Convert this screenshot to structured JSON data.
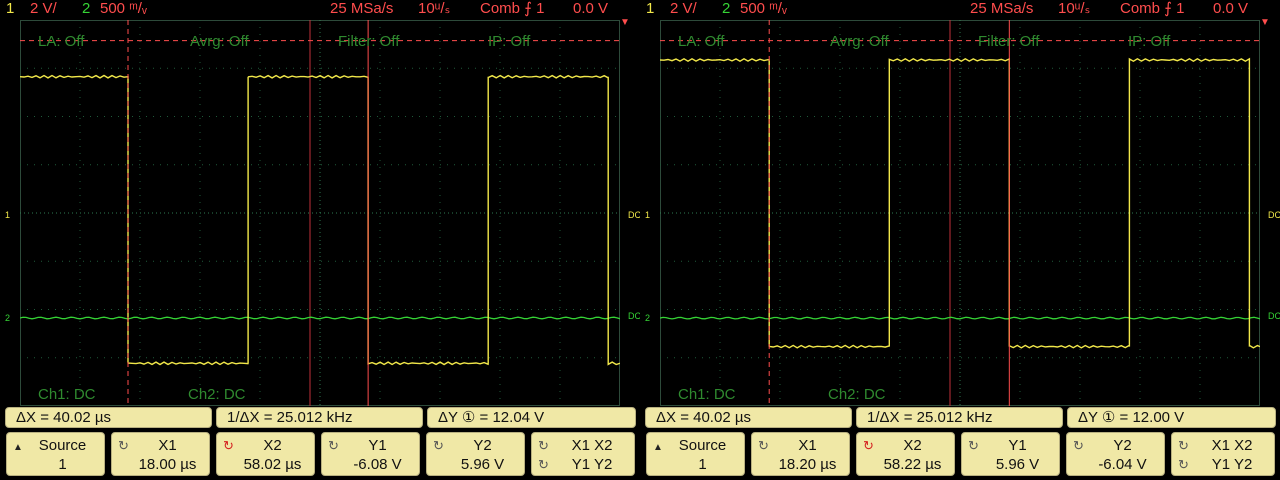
{
  "screens": [
    {
      "header": {
        "ch1_num": "1",
        "ch1_scale": "2 V/",
        "ch2_num": "2",
        "ch2_scale": "500 ᵐ/ᵥ",
        "sample_rate": "25 MSa/s",
        "timebase": "10ᵘ/ₛ",
        "trigger": "Comb  ⨍ 1",
        "trigger_level": "0.0 V"
      },
      "overlay": {
        "la": "LA: Off",
        "avrg": "Avrg: Off",
        "filter": "Filter: Off",
        "ip": "IP: Off",
        "ch1_coupling": "Ch1: DC",
        "ch2_coupling": "Ch2: DC"
      },
      "markers": {
        "ch1": "1",
        "ch2": "2",
        "dc": "DC"
      },
      "measurements": {
        "dx": "ΔX = 40.02 µs",
        "inv_dx": "1/ΔX = 25.012 kHz",
        "dy": "ΔY ① = 12.04  V"
      },
      "softkeys": {
        "source_label": "Source",
        "source_value": "1",
        "x1_label": "X1",
        "x1_value": "18.00 µs",
        "x2_label": "X2",
        "x2_value": "58.02 µs",
        "y1_label": "Y1",
        "y1_value": "-6.08  V",
        "y2_label": "Y2",
        "y2_value": "5.96  V",
        "xy_line1": "X1  X2",
        "xy_line2": "Y1  Y2"
      },
      "waveform": {
        "ch1_high_v": 6.0,
        "ch1_low_v": -6.0,
        "ch1_period_us": 40.02,
        "ch1_first_fall_us": 18.0,
        "ch2_level_v": -0.25,
        "cursor_x1_us": 18.0,
        "cursor_x2_us": 58.02,
        "cursor_y1_v": -6.08,
        "cursor_y2_v": 5.96
      }
    },
    {
      "header": {
        "ch1_num": "1",
        "ch1_scale": "2 V/",
        "ch2_num": "2",
        "ch2_scale": "500 ᵐ/ᵥ",
        "sample_rate": "25 MSa/s",
        "timebase": "10ᵘ/ₛ",
        "trigger": "Comb  ⨍ 1",
        "trigger_level": "0.0 V"
      },
      "overlay": {
        "la": "LA: Off",
        "avrg": "Avrg: Off",
        "filter": "Filter: Off",
        "ip": "IP: Off",
        "ch1_coupling": "Ch1: DC",
        "ch2_coupling": "Ch2: DC"
      },
      "markers": {
        "ch1": "1",
        "ch2": "2",
        "dc": "DC"
      },
      "measurements": {
        "dx": "ΔX = 40.02 µs",
        "inv_dx": "1/ΔX = 25.012 kHz",
        "dy": "ΔY ① = 12.00  V"
      },
      "softkeys": {
        "source_label": "Source",
        "source_value": "1",
        "x1_label": "X1",
        "x1_value": "18.20 µs",
        "x2_label": "X2",
        "x2_value": "58.22 µs",
        "y1_label": "Y1",
        "y1_value": "5.96  V",
        "y2_label": "Y2",
        "y2_value": "-6.04  V",
        "xy_line1": "X1  X2",
        "xy_line2": "Y1  Y2"
      },
      "waveform": {
        "ch1_high_v": 6.7,
        "ch1_low_v": -5.3,
        "ch1_period_us": 40.02,
        "ch1_first_fall_us": 18.2,
        "ch2_level_v": -0.22,
        "cursor_x1_us": 18.2,
        "cursor_x2_us": 58.22,
        "cursor_y1_v": 5.96,
        "cursor_y2_v": -6.04
      }
    }
  ],
  "colors": {
    "ch1": "#f2e84a",
    "ch2": "#35d335",
    "cursor": "#ff4d4d",
    "grid": "#1f5a3a",
    "overlay_text": "#2f8a2f",
    "softkey_bg": "#f0e8a6"
  }
}
